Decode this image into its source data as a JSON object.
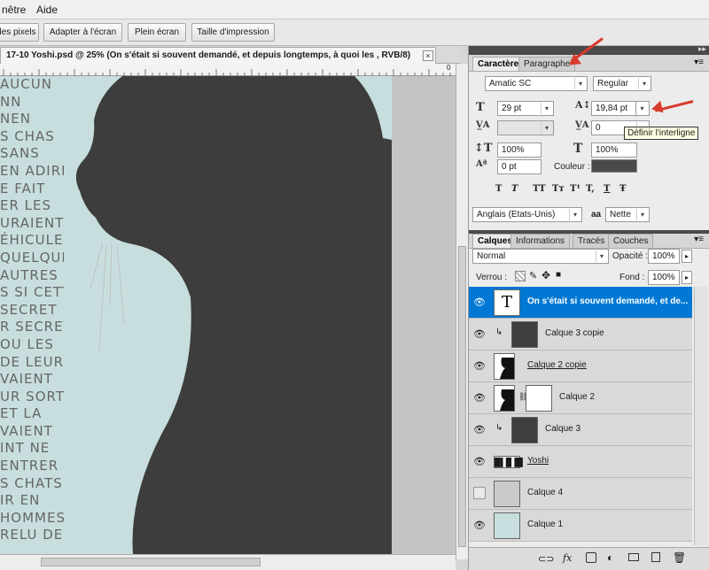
{
  "menu": {
    "items": [
      "nêtre",
      "Aide"
    ]
  },
  "options_bar": {
    "buttons": [
      "les pixels",
      "Adapter à l'écran",
      "Plein écran",
      "Taille d'impression"
    ]
  },
  "document": {
    "tab_title": "17-10 Yoshi.psd @ 25% (On s'était si souvent demandé, et depuis longtemps, à quoi les , RVB/8)",
    "close_glyph": "×",
    "ruler_mark": "0",
    "canvas_text_lines": [
      "AUCUN",
      "NN",
      "NEN",
      "S CHAS",
      "SANS",
      "EN ADIRE",
      "E FAIT",
      "ER LES",
      "URAIENT",
      "ÉHICULE",
      "QUELQUE",
      "AUTRES",
      "S SI CETTE",
      "SECRET",
      "R SECRET",
      "OU LES",
      "DE LEUR",
      "VAIENT",
      "UR SORT",
      "ET LA",
      "VAIENT",
      "INT NE",
      "ENTRER",
      "S CHATS",
      "IR EN",
      "HOMMES",
      "RELU DE"
    ]
  },
  "character_panel": {
    "tabs": [
      "Caractère",
      "Paragraphe"
    ],
    "font_family": "Amatic SC",
    "font_style": "Regular",
    "font_size": "29 pt",
    "leading": "19,84 pt",
    "kerning": "",
    "tracking": "0",
    "vertical_scale": "100%",
    "horizontal_scale": "100%",
    "baseline_shift": "0 pt",
    "color_label": "Couleur :",
    "color": "#4a4a4a",
    "tooltip": "Définir l'interligne",
    "format_buttons": [
      "T",
      "T",
      "TT",
      "Tт",
      "T¹",
      "T,",
      "T",
      "Ŧ"
    ],
    "language": "Anglais (Etats-Unis)",
    "aa_label": "aa",
    "antialias": "Nette",
    "icons": [
      "font-size-icon",
      "kerning-icon",
      "leading-icon",
      "tracking-icon",
      "vertical-scale-icon",
      "horizontal-scale-icon",
      "baseline-shift-icon"
    ]
  },
  "layers_panel": {
    "tabs": [
      "Calques",
      "Informations",
      "Tracés",
      "Couches"
    ],
    "blend_mode": "Normal",
    "opacity_label": "Opacité :",
    "opacity": "100%",
    "lock_label": "Verrou :",
    "fill_label": "Fond :",
    "fill": "100%",
    "layers": [
      {
        "name": "On s'était si souvent demandé, et de...",
        "visible": true,
        "selected": true,
        "kind": "text"
      },
      {
        "name": "Calque 3 copie",
        "visible": true,
        "selected": false,
        "kind": "dark",
        "clipped": true
      },
      {
        "name": "Calque 2 copie",
        "visible": true,
        "selected": false,
        "kind": "cat"
      },
      {
        "name": "Calque 2",
        "visible": true,
        "selected": false,
        "kind": "cat-mask"
      },
      {
        "name": "Calque 3",
        "visible": true,
        "selected": false,
        "kind": "dark",
        "clipped": true
      },
      {
        "name": "Yoshi",
        "visible": true,
        "selected": false,
        "kind": "word"
      },
      {
        "name": "Calque 4",
        "visible": false,
        "selected": false,
        "kind": "grey"
      },
      {
        "name": "Calque 1",
        "visible": true,
        "selected": false,
        "kind": "blue"
      }
    ],
    "footer_icons": [
      "link-icon",
      "fx-icon",
      "mask-icon",
      "adjustment-icon",
      "folder-icon",
      "new-layer-icon",
      "trash-icon"
    ],
    "fx_label": "fx"
  },
  "colors": {
    "selection": "#0078d4",
    "arrow": "#d83a2c",
    "canvas_bg": "#c8dede",
    "cat": "#3a3a3a"
  }
}
